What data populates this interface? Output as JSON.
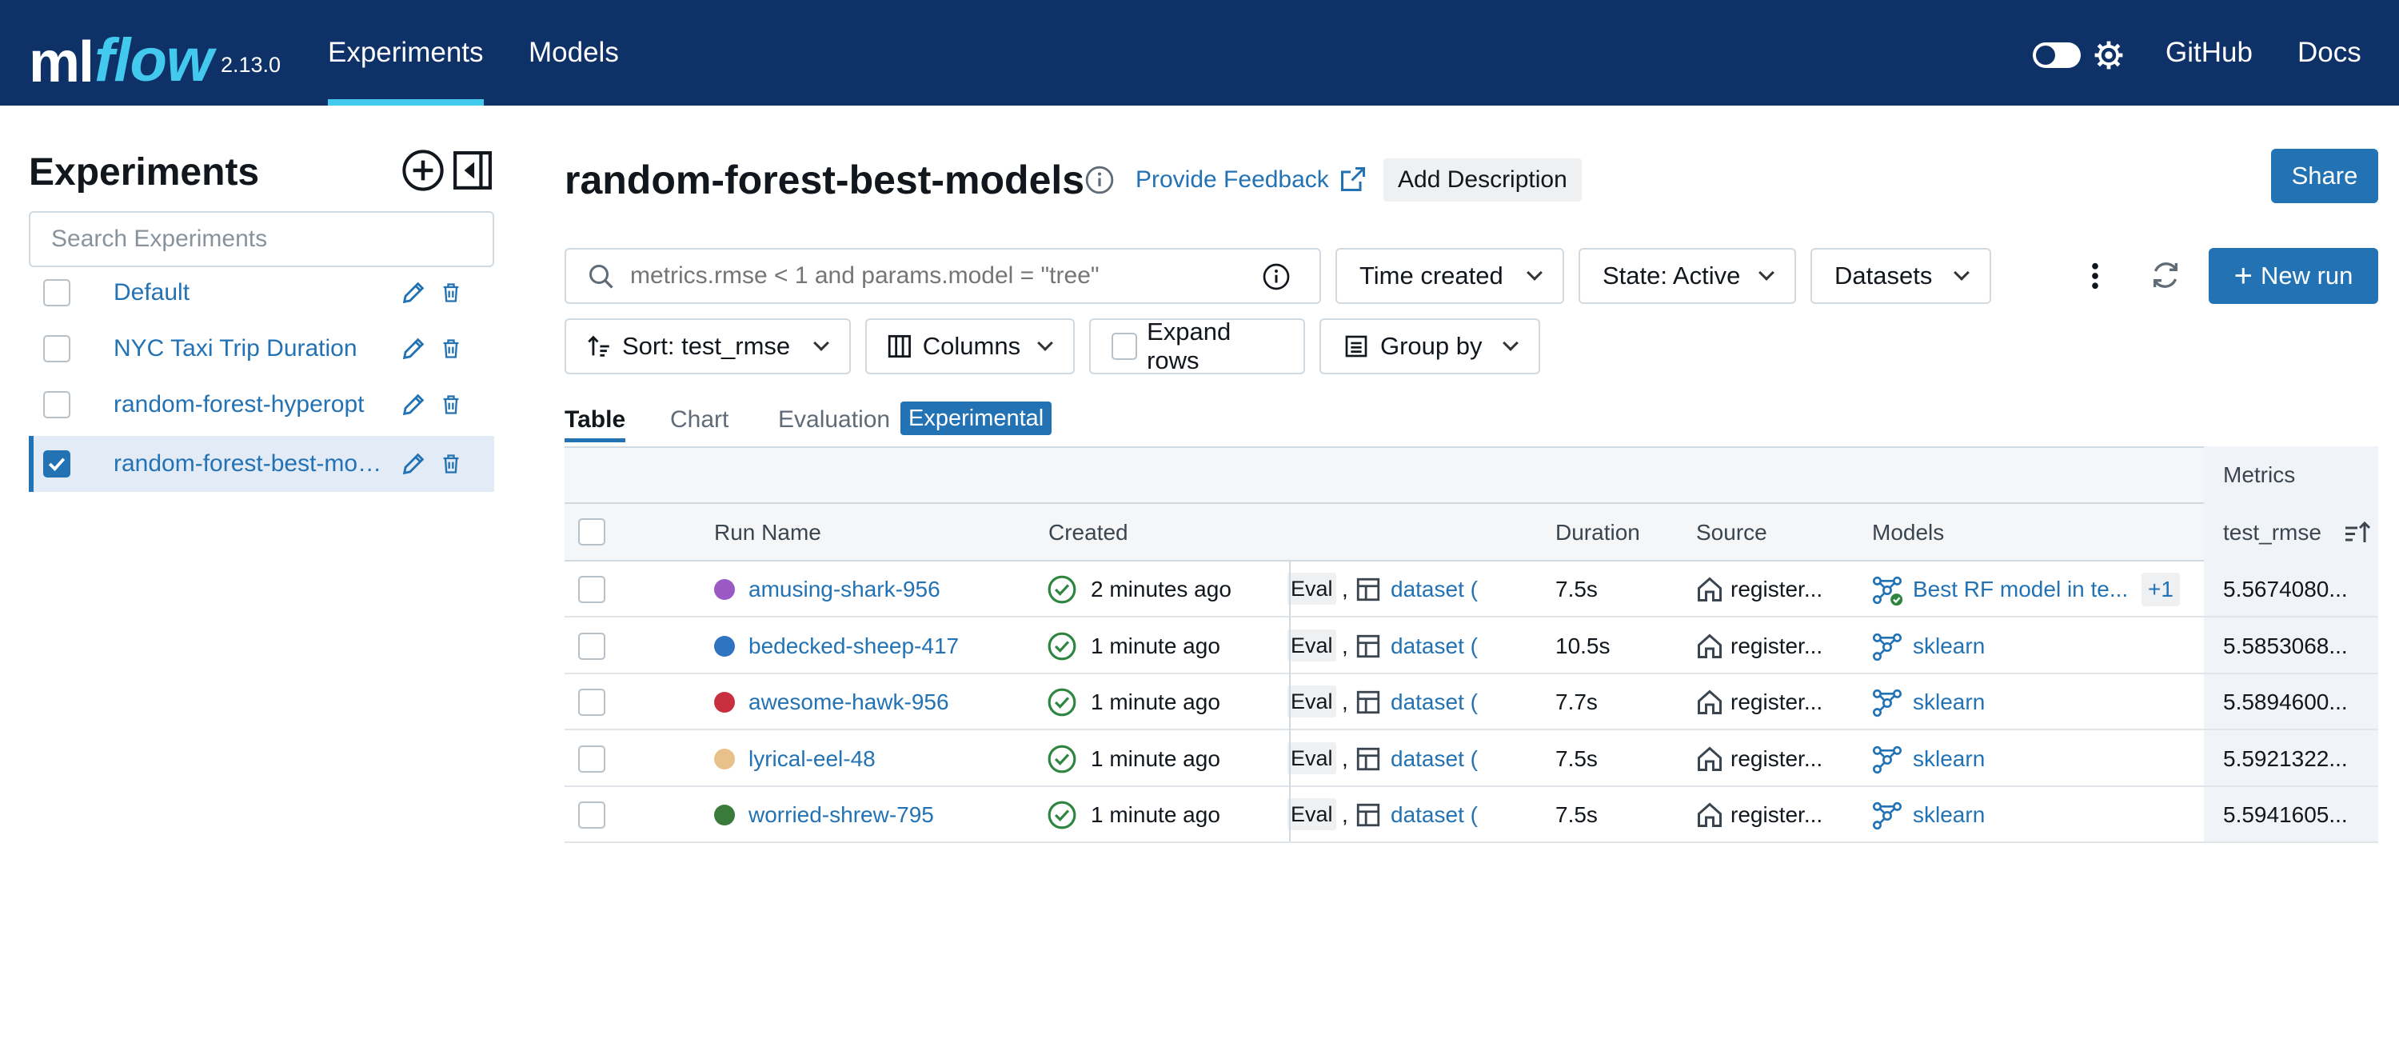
{
  "header": {
    "logo_ml": "ml",
    "logo_flow": "flow",
    "version": "2.13.0",
    "nav": [
      "Experiments",
      "Models"
    ],
    "links": [
      "GitHub",
      "Docs"
    ]
  },
  "sidebar": {
    "title": "Experiments",
    "search_placeholder": "Search Experiments",
    "items": [
      {
        "label": "Default",
        "checked": false
      },
      {
        "label": "NYC Taxi Trip Duration",
        "checked": false
      },
      {
        "label": "random-forest-hyperopt",
        "checked": false
      },
      {
        "label": "random-forest-best-models",
        "checked": true
      }
    ]
  },
  "main": {
    "title": "random-forest-best-models",
    "feedback_label": "Provide Feedback",
    "add_description_label": "Add Description",
    "share_label": "Share",
    "search_placeholder": "metrics.rmse < 1 and params.model = \"tree\"",
    "filters": {
      "time": "Time created",
      "state": "State: Active",
      "datasets": "Datasets",
      "new_run": "New run"
    },
    "controls": {
      "sort": "Sort: test_rmse",
      "columns": "Columns",
      "expand": "Expand rows",
      "group": "Group by"
    },
    "tabs": [
      "Table",
      "Chart",
      "Evaluation"
    ],
    "experimental_badge": "Experimental"
  },
  "table": {
    "group_header": "Metrics",
    "columns": {
      "run_name": "Run Name",
      "created": "Created",
      "duration": "Duration",
      "source": "Source",
      "models": "Models",
      "metric": "test_rmse"
    },
    "rows": [
      {
        "run": "amusing-shark-956",
        "color": "#9b59c5",
        "created": "2 minutes ago",
        "eval": "Eval",
        "sep": ",",
        "dataset": "dataset (",
        "duration": "7.5s",
        "source": "register...",
        "model": "Best RF model in te...",
        "extra": "+1",
        "metric": "5.5674080..."
      },
      {
        "run": "bedecked-sheep-417",
        "color": "#2f74c0",
        "created": "1 minute ago",
        "eval": "Eval",
        "sep": ",",
        "dataset": "dataset (",
        "duration": "10.5s",
        "source": "register...",
        "model": "sklearn",
        "extra": "",
        "metric": "5.5853068..."
      },
      {
        "run": "awesome-hawk-956",
        "color": "#c8303f",
        "created": "1 minute ago",
        "eval": "Eval",
        "sep": ",",
        "dataset": "dataset (",
        "duration": "7.7s",
        "source": "register...",
        "model": "sklearn",
        "extra": "",
        "metric": "5.5894600..."
      },
      {
        "run": "lyrical-eel-48",
        "color": "#e8c08a",
        "created": "1 minute ago",
        "eval": "Eval",
        "sep": ",",
        "dataset": "dataset (",
        "duration": "7.5s",
        "source": "register...",
        "model": "sklearn",
        "extra": "",
        "metric": "5.5921322..."
      },
      {
        "run": "worried-shrew-795",
        "color": "#3a7a3a",
        "created": "1 minute ago",
        "eval": "Eval",
        "sep": ",",
        "dataset": "dataset (",
        "duration": "7.5s",
        "source": "register...",
        "model": "sklearn",
        "extra": "",
        "metric": "5.5941605..."
      }
    ]
  },
  "colors": {
    "header_bg": "#0e3168",
    "accent": "#2272b4",
    "logo_flow": "#43c9ed",
    "success": "#2e8540"
  }
}
